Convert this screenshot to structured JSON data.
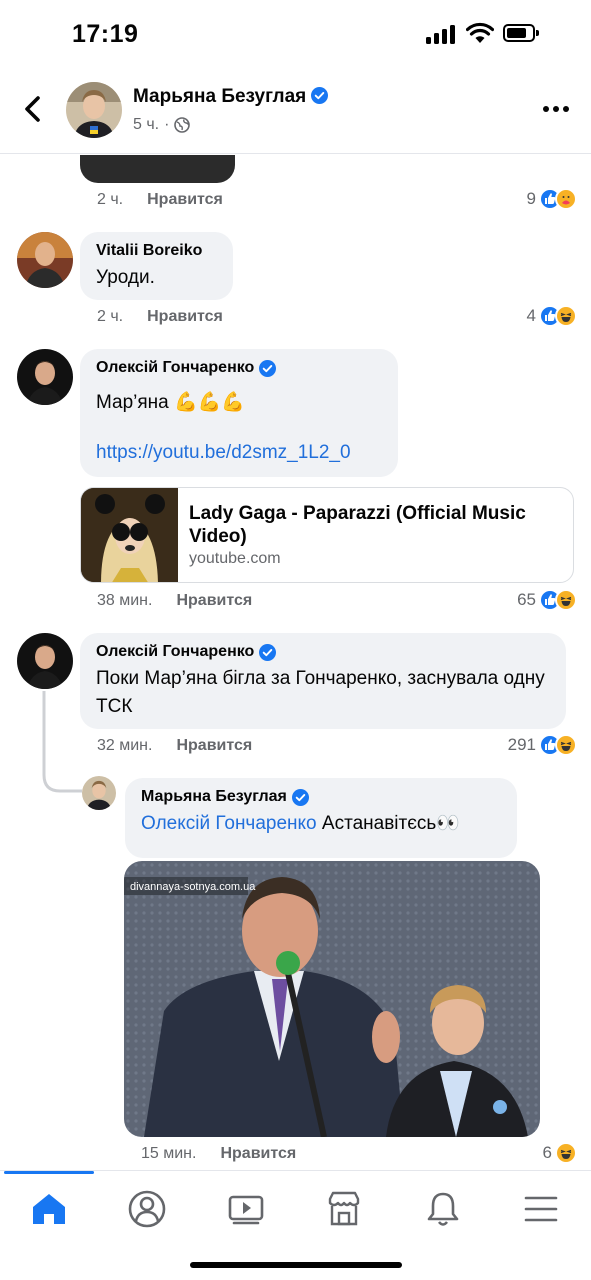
{
  "status_bar": {
    "time": "17:19"
  },
  "header": {
    "name": "Марьяна Безуглая",
    "time_ago": "5 ч.",
    "dot": "·",
    "icons": {
      "back": "back-chevron-icon",
      "verified": "verified-badge-icon",
      "audience": "globe-icon",
      "more": "more-dots-icon"
    }
  },
  "comments": [
    {
      "time": "2 ч.",
      "like_label": "Нравится",
      "reaction_count": "9",
      "reactions": [
        "like",
        "care"
      ]
    },
    {
      "author": "Vitalii Boreiko",
      "text": "Уроди.",
      "time": "2 ч.",
      "like_label": "Нравится",
      "reaction_count": "4",
      "reactions": [
        "like",
        "haha"
      ]
    },
    {
      "author": "Олексій Гончаренко",
      "verified": true,
      "text": "Мар’яна",
      "emoji": "💪💪💪",
      "url": "https://youtu.be/d2smz_1L2_0",
      "link_card": {
        "title": "Lady Gaga - Paparazzi (Official Music Video)",
        "domain": "youtube.com"
      },
      "time": "38 мин.",
      "like_label": "Нравится",
      "reaction_count": "65",
      "reactions": [
        "like",
        "haha"
      ]
    },
    {
      "author": "Олексій Гончаренко",
      "verified": true,
      "text": "Поки Мар’яна бігла за Гончаренко, заснувала одну ТСК",
      "time": "32 мин.",
      "like_label": "Нравится",
      "reaction_count": "291",
      "reactions": [
        "like",
        "haha"
      ]
    },
    {
      "author": "Марьяна Безуглая",
      "verified": true,
      "mention": "Олексій Гончаренко",
      "text": "Астанавітєсь👀",
      "image_watermark": "divannaya-sotnya.com.ua",
      "time": "15 мин.",
      "like_label": "Нравится",
      "reaction_count": "6",
      "reactions": [
        "haha"
      ]
    }
  ],
  "bottom_nav": {
    "items": [
      "home-icon",
      "profile-icon",
      "watch-icon",
      "marketplace-icon",
      "notifications-icon",
      "menu-icon"
    ],
    "active": "home-icon",
    "active_color": "#1877f2"
  },
  "colors": {
    "link": "#216fdb",
    "bubble": "#f0f2f5",
    "secondary_text": "#65676b",
    "like": "#1877f2",
    "haha": "#f7b125"
  }
}
